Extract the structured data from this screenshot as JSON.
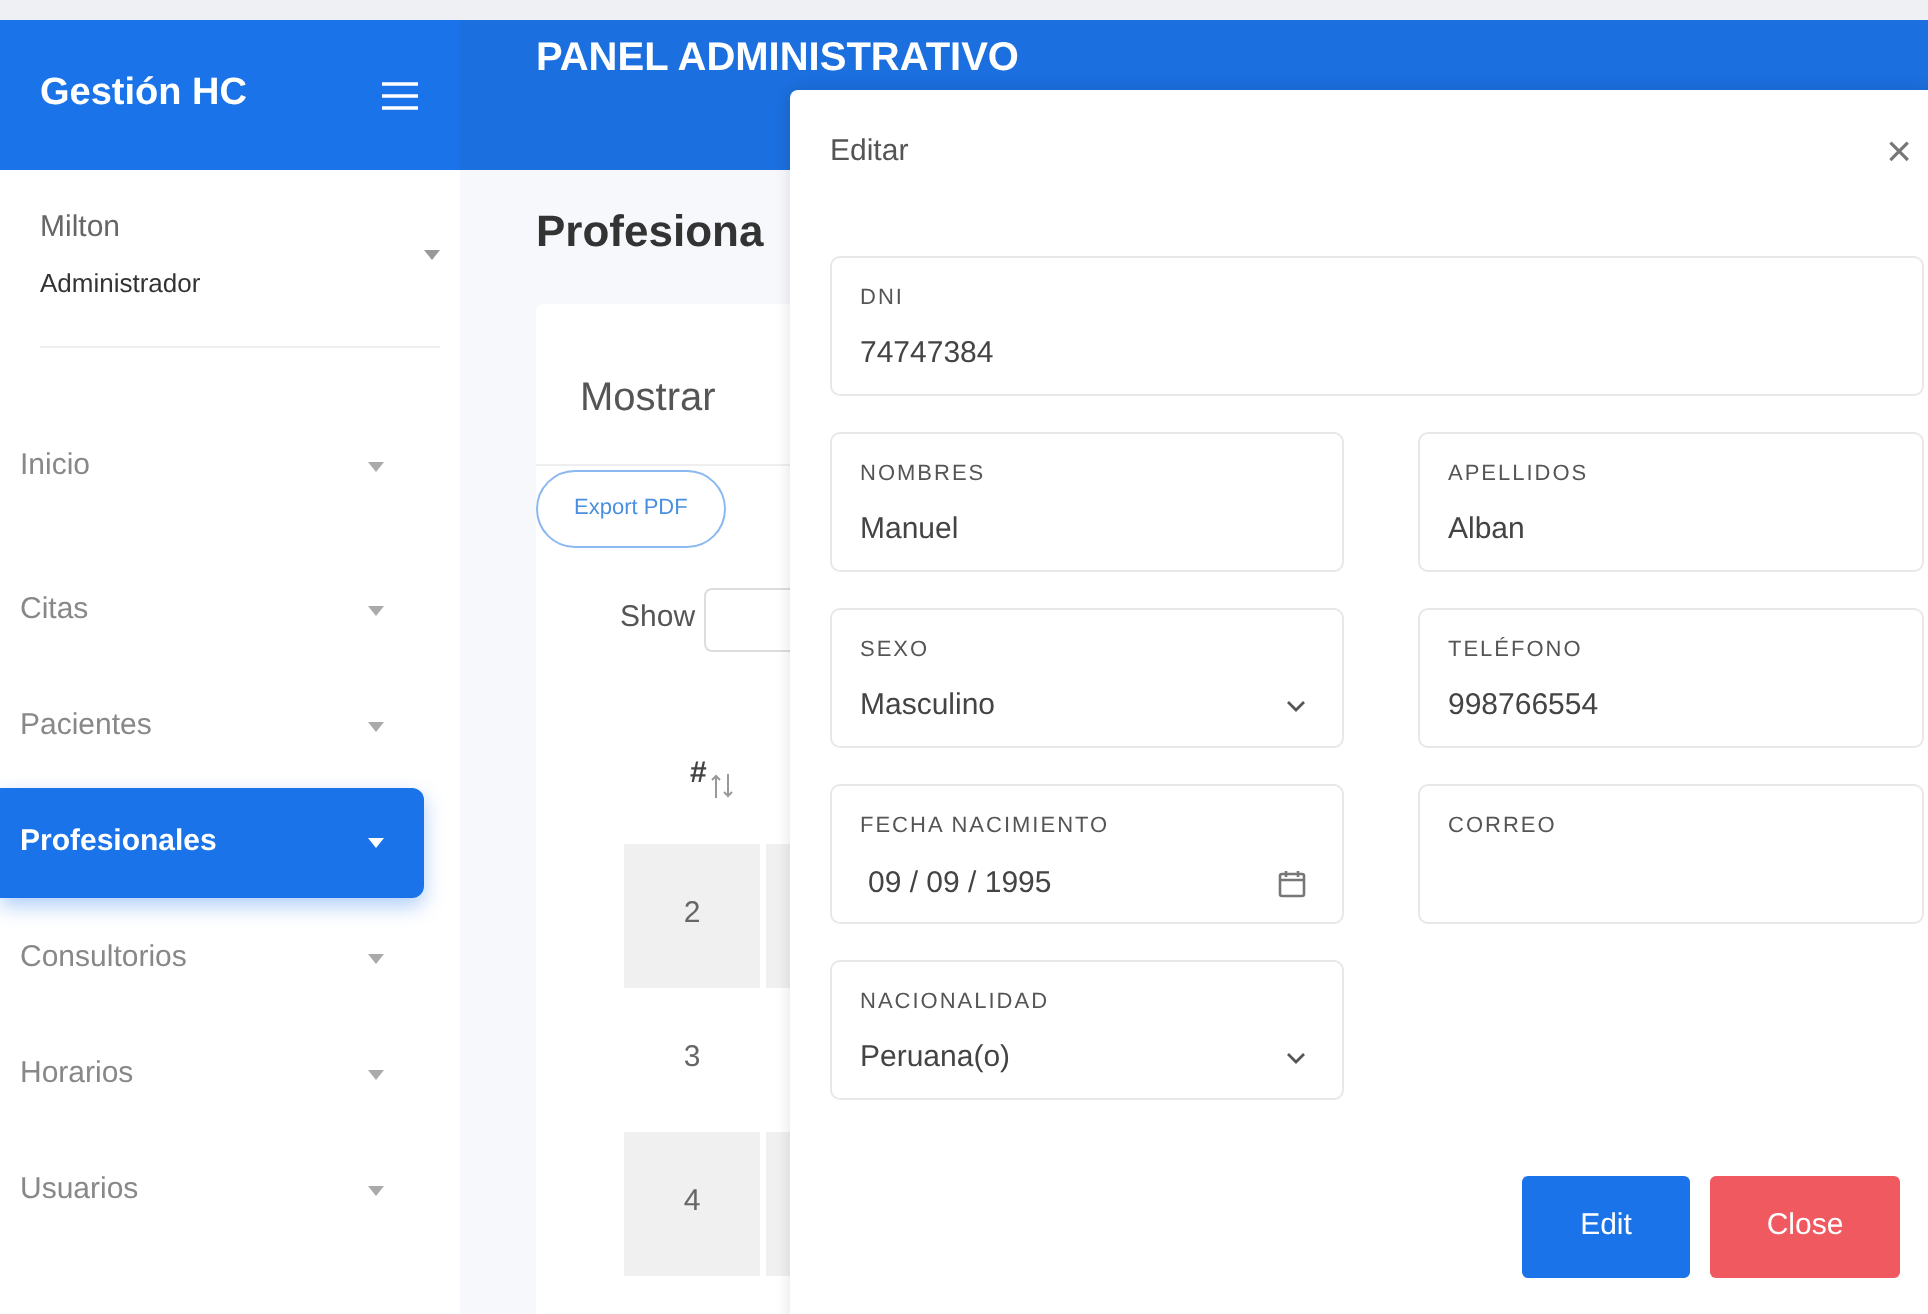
{
  "sidebar": {
    "brand": "Gestión HC",
    "user": {
      "name": "Milton",
      "role": "Administrador"
    },
    "items": [
      {
        "label": "Inicio",
        "selected": false
      },
      {
        "label": "Citas",
        "selected": false
      },
      {
        "label": "Pacientes",
        "selected": false
      },
      {
        "label": "Profesionales",
        "selected": true
      },
      {
        "label": "Consultorios",
        "selected": false
      },
      {
        "label": "Horarios",
        "selected": false
      },
      {
        "label": "Usuarios",
        "selected": false
      }
    ]
  },
  "header": {
    "title": "PANEL ADMINISTRATIVO"
  },
  "page": {
    "title": "Profesiona",
    "card_title": "Mostrar",
    "export_button": "Export PDF",
    "show_label": "Show",
    "table": {
      "columns": [
        "#"
      ],
      "rows": [
        {
          "number": "2",
          "striped": true
        },
        {
          "number": "3",
          "striped": false
        },
        {
          "number": "4",
          "striped": true
        }
      ]
    }
  },
  "modal": {
    "title": "Editar",
    "close": "×",
    "fields": [
      {
        "label": "DNI",
        "value": "74747384",
        "kind": "text",
        "wide": true
      },
      {
        "label": "NOMBRES",
        "value": "Manuel",
        "kind": "text",
        "wide": false
      },
      {
        "label": "APELLIDOS",
        "value": "Alban",
        "kind": "text",
        "wide": false
      },
      {
        "label": "SEXO",
        "value": "Masculino",
        "kind": "select",
        "wide": false
      },
      {
        "label": "TELÉFONO",
        "value": "998766554",
        "kind": "text",
        "wide": false
      },
      {
        "label": "FECHA NACIMIENTO",
        "value": "09 / 09 / 1995",
        "kind": "date",
        "wide": false
      },
      {
        "label": "CORREO",
        "kind": "text",
        "wide": false
      },
      {
        "label": "NACIONALIDAD",
        "value": "Peruana(o)",
        "kind": "select",
        "wide": false
      }
    ],
    "buttons": [
      {
        "label": "Edit",
        "kind": "primary"
      },
      {
        "label": "Close",
        "kind": "danger"
      }
    ]
  }
}
